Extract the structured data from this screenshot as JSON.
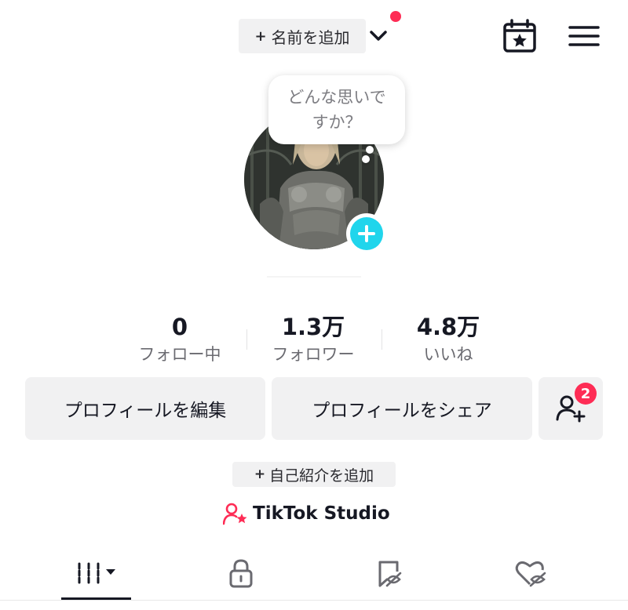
{
  "header": {
    "add_name_plus": "+",
    "add_name_label": "名前を追加",
    "notification_dot_color": "#fe2c55",
    "calendar_icon": "calendar-star-icon",
    "menu_icon": "hamburger-menu-icon"
  },
  "avatar": {
    "thought_line1": "どんな思いで",
    "thought_line2": "すか？",
    "add_icon": "plus-icon",
    "add_color": "#20d5ec"
  },
  "stats": [
    {
      "value": "0",
      "label": "フォロー中"
    },
    {
      "value": "1.3万",
      "label": "フォロワー"
    },
    {
      "value": "4.8万",
      "label": "いいね"
    }
  ],
  "actions": {
    "edit_profile": "プロフィールを編集",
    "share_profile": "プロフィールをシェア",
    "friend_badge": "2"
  },
  "bio": {
    "plus": "+",
    "label": "自己紹介を追加"
  },
  "studio": {
    "label": "TikTok Studio",
    "icon_color": "#fe2c55"
  },
  "tabs": [
    {
      "icon": "videos-grid-icon",
      "selected": true
    },
    {
      "icon": "lock-icon",
      "selected": false
    },
    {
      "icon": "bookmark-hidden-icon",
      "selected": false
    },
    {
      "icon": "heart-hidden-icon",
      "selected": false
    }
  ]
}
